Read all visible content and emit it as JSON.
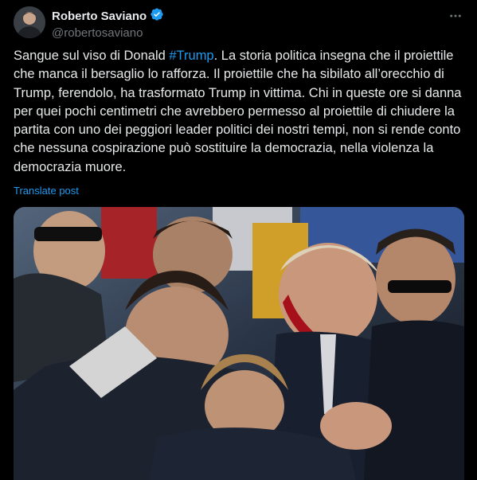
{
  "tweet": {
    "author": {
      "display_name": "Roberto Saviano",
      "handle": "@robertosaviano",
      "verified": true
    },
    "more_icon": "more-horizontal-icon",
    "text_before": "Sangue sul viso di Donald ",
    "hashtag": "#Trump",
    "text_after": ". La storia politica insegna che il proiettile che manca il bersaglio lo rafforza. Il proiettile che ha sibilato all’orecchio di Trump, ferendolo, ha trasformato Trump in vittima. Chi in queste ore si danna per quei pochi centimetri che avrebbero permesso al proiettile di chiudere la partita con uno dei peggiori leader politici dei nostri tempi, non si rende conto che nessuna cospirazione può sostituire la democrazia, nella violenza la democrazia muore.",
    "translate_label": "Translate post"
  },
  "colors": {
    "background": "#000000",
    "text": "#e7e9ea",
    "secondary": "#71767b",
    "accent": "#1d9bf0"
  }
}
